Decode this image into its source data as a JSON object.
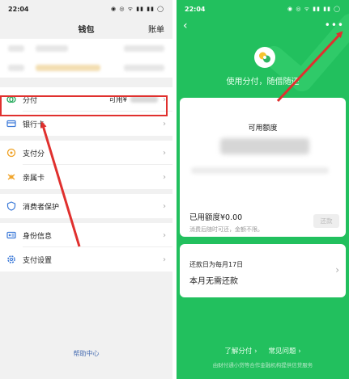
{
  "left": {
    "status": {
      "time": "22:04",
      "icons": "◉ ◎ ᯤ ▮▮ ▮▮ ◯"
    },
    "header": {
      "title": "钱包",
      "action": "账单"
    },
    "menu": {
      "fenfu": {
        "label": "分付",
        "available": "可用¥"
      },
      "bank": {
        "label": "银行卡"
      },
      "payscore": {
        "label": "支付分"
      },
      "family": {
        "label": "亲属卡"
      },
      "consumer": {
        "label": "消费者保护"
      },
      "identity": {
        "label": "身份信息"
      },
      "settings": {
        "label": "支付设置"
      }
    },
    "help": "帮助中心"
  },
  "right": {
    "status": {
      "time": "22:04",
      "icons": "◉ ◎ ᯤ ▮▮ ▮▮ ◯"
    },
    "slogan": "使用分付，随借随还",
    "card": {
      "credit_label": "可用额度",
      "used": "已用额度¥0.00",
      "note": "消费后随时可还，金额不限。",
      "repay_button": "还款"
    },
    "due": {
      "line1": "还款日为每月17日",
      "line2": "本月无需还款"
    },
    "links": {
      "learn": "了解分付 ›",
      "faq": "常见问题 ›"
    },
    "footer": "由财付通小贷等合作金融机构提供信贷服务"
  },
  "colors": {
    "brand_green": "#22c05e",
    "highlight_red": "#e0302e",
    "link_blue": "#4a6fb3"
  }
}
